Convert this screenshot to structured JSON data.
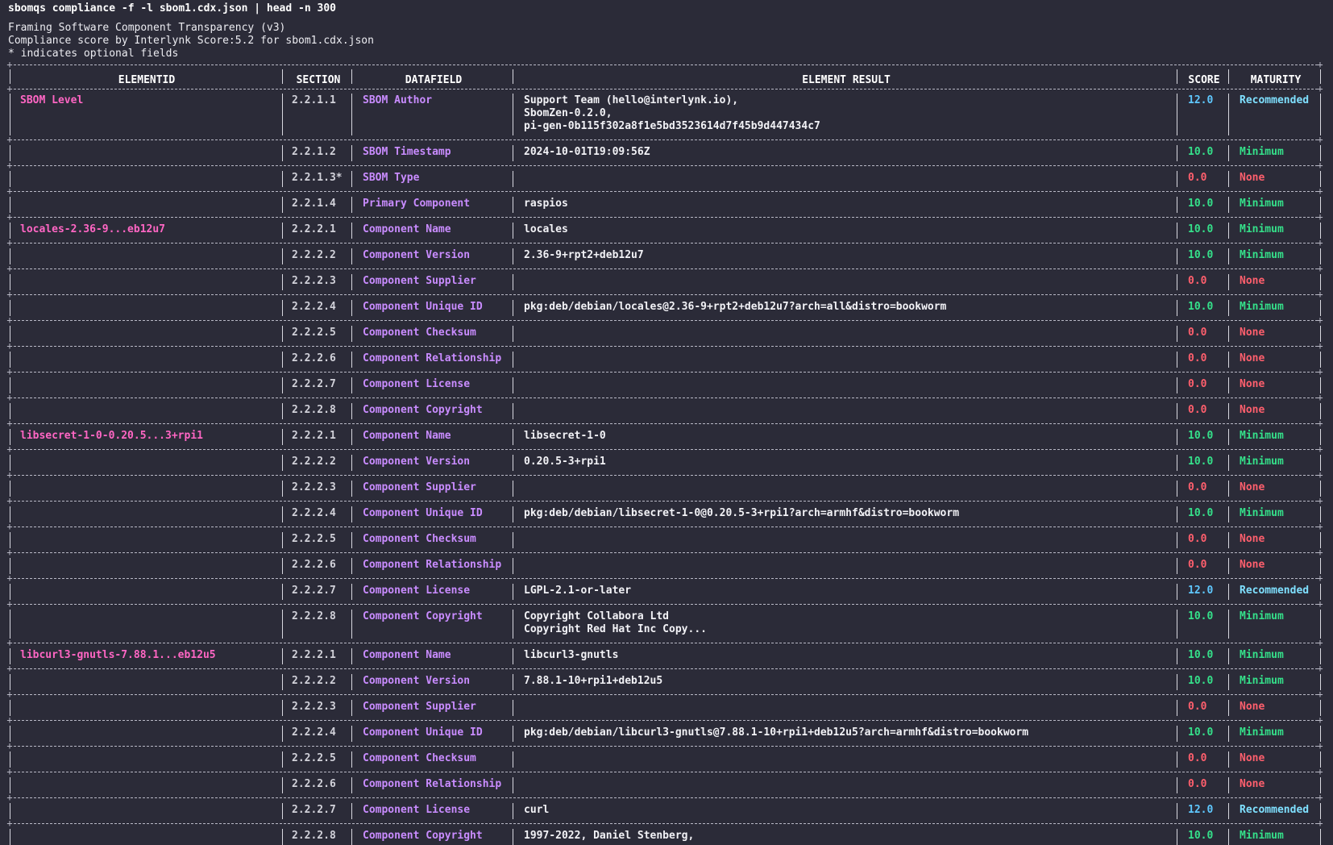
{
  "command": "sbomqs compliance -f -l sbom1.cdx.json | head -n 300",
  "header_lines": [
    "Framing Software Component Transparency (v3)",
    "Compliance score by Interlynk Score:5.2 for sbom1.cdx.json",
    "* indicates optional fields"
  ],
  "columns": [
    "ELEMENTID",
    "SECTION",
    "DATAFIELD",
    "ELEMENT RESULT",
    "SCORE",
    "MATURITY"
  ],
  "colors": {
    "element_id": "#ff66c4",
    "datafield": "#c98cff",
    "score_pass": "#35e08a",
    "score_fail": "#ff5f6d",
    "score_recommended": "#5fc8ff",
    "maturity_minimum": "#35e08a",
    "maturity_none": "#ff5f6d",
    "maturity_recommended": "#7fe0ff",
    "background": "#2b2b38"
  },
  "rows": [
    {
      "element": "SBOM Level",
      "section": "2.2.1.1",
      "field": "SBOM Author",
      "result": [
        "Support Team (hello@interlynk.io),",
        "SbomZen-0.2.0,",
        "pi-gen-0b115f302a8f1e5bd3523614d7f45b9d447434c7"
      ],
      "score": "12.0",
      "maturity": "Recommended"
    },
    {
      "element": "",
      "section": "2.2.1.2",
      "field": "SBOM Timestamp",
      "result": [
        "2024-10-01T19:09:56Z"
      ],
      "score": "10.0",
      "maturity": "Minimum"
    },
    {
      "element": "",
      "section": "2.2.1.3*",
      "field": "SBOM Type",
      "result": [
        ""
      ],
      "score": "0.0",
      "maturity": "None"
    },
    {
      "element": "",
      "section": "2.2.1.4",
      "field": "Primary Component",
      "result": [
        "raspios"
      ],
      "score": "10.0",
      "maturity": "Minimum"
    },
    {
      "element": "locales-2.36-9...eb12u7",
      "section": "2.2.2.1",
      "field": "Component Name",
      "result": [
        "locales"
      ],
      "score": "10.0",
      "maturity": "Minimum"
    },
    {
      "element": "",
      "section": "2.2.2.2",
      "field": "Component Version",
      "result": [
        "2.36-9+rpt2+deb12u7"
      ],
      "score": "10.0",
      "maturity": "Minimum"
    },
    {
      "element": "",
      "section": "2.2.2.3",
      "field": "Component Supplier",
      "result": [
        ""
      ],
      "score": "0.0",
      "maturity": "None"
    },
    {
      "element": "",
      "section": "2.2.2.4",
      "field": "Component Unique ID",
      "result": [
        "pkg:deb/debian/locales@2.36-9+rpt2+deb12u7?arch=all&distro=bookworm"
      ],
      "score": "10.0",
      "maturity": "Minimum"
    },
    {
      "element": "",
      "section": "2.2.2.5",
      "field": "Component Checksum",
      "result": [
        ""
      ],
      "score": "0.0",
      "maturity": "None"
    },
    {
      "element": "",
      "section": "2.2.2.6",
      "field": "Component Relationship",
      "result": [
        ""
      ],
      "score": "0.0",
      "maturity": "None"
    },
    {
      "element": "",
      "section": "2.2.2.7",
      "field": "Component License",
      "result": [
        ""
      ],
      "score": "0.0",
      "maturity": "None"
    },
    {
      "element": "",
      "section": "2.2.2.8",
      "field": "Component Copyright",
      "result": [
        ""
      ],
      "score": "0.0",
      "maturity": "None"
    },
    {
      "element": "libsecret-1-0-0.20.5...3+rpi1",
      "section": "2.2.2.1",
      "field": "Component Name",
      "result": [
        "libsecret-1-0"
      ],
      "score": "10.0",
      "maturity": "Minimum"
    },
    {
      "element": "",
      "section": "2.2.2.2",
      "field": "Component Version",
      "result": [
        "0.20.5-3+rpi1"
      ],
      "score": "10.0",
      "maturity": "Minimum"
    },
    {
      "element": "",
      "section": "2.2.2.3",
      "field": "Component Supplier",
      "result": [
        ""
      ],
      "score": "0.0",
      "maturity": "None"
    },
    {
      "element": "",
      "section": "2.2.2.4",
      "field": "Component Unique ID",
      "result": [
        "pkg:deb/debian/libsecret-1-0@0.20.5-3+rpi1?arch=armhf&distro=bookworm"
      ],
      "score": "10.0",
      "maturity": "Minimum"
    },
    {
      "element": "",
      "section": "2.2.2.5",
      "field": "Component Checksum",
      "result": [
        ""
      ],
      "score": "0.0",
      "maturity": "None"
    },
    {
      "element": "",
      "section": "2.2.2.6",
      "field": "Component Relationship",
      "result": [
        ""
      ],
      "score": "0.0",
      "maturity": "None"
    },
    {
      "element": "",
      "section": "2.2.2.7",
      "field": "Component License",
      "result": [
        "LGPL-2.1-or-later"
      ],
      "score": "12.0",
      "maturity": "Recommended"
    },
    {
      "element": "",
      "section": "2.2.2.8",
      "field": "Component Copyright",
      "result": [
        "Copyright Collabora Ltd",
        "Copyright Red Hat Inc Copy..."
      ],
      "score": "10.0",
      "maturity": "Minimum"
    },
    {
      "element": "libcurl3-gnutls-7.88.1...eb12u5",
      "section": "2.2.2.1",
      "field": "Component Name",
      "result": [
        "libcurl3-gnutls"
      ],
      "score": "10.0",
      "maturity": "Minimum"
    },
    {
      "element": "",
      "section": "2.2.2.2",
      "field": "Component Version",
      "result": [
        "7.88.1-10+rpi1+deb12u5"
      ],
      "score": "10.0",
      "maturity": "Minimum"
    },
    {
      "element": "",
      "section": "2.2.2.3",
      "field": "Component Supplier",
      "result": [
        ""
      ],
      "score": "0.0",
      "maturity": "None"
    },
    {
      "element": "",
      "section": "2.2.2.4",
      "field": "Component Unique ID",
      "result": [
        "pkg:deb/debian/libcurl3-gnutls@7.88.1-10+rpi1+deb12u5?arch=armhf&distro=bookworm"
      ],
      "score": "10.0",
      "maturity": "Minimum"
    },
    {
      "element": "",
      "section": "2.2.2.5",
      "field": "Component Checksum",
      "result": [
        ""
      ],
      "score": "0.0",
      "maturity": "None"
    },
    {
      "element": "",
      "section": "2.2.2.6",
      "field": "Component Relationship",
      "result": [
        ""
      ],
      "score": "0.0",
      "maturity": "None"
    },
    {
      "element": "",
      "section": "2.2.2.7",
      "field": "Component License",
      "result": [
        "curl"
      ],
      "score": "12.0",
      "maturity": "Recommended"
    },
    {
      "element": "",
      "section": "2.2.2.8",
      "field": "Component Copyright",
      "result": [
        "1997-2022, Daniel Stenberg,"
      ],
      "score": "10.0",
      "maturity": "Minimum"
    }
  ]
}
